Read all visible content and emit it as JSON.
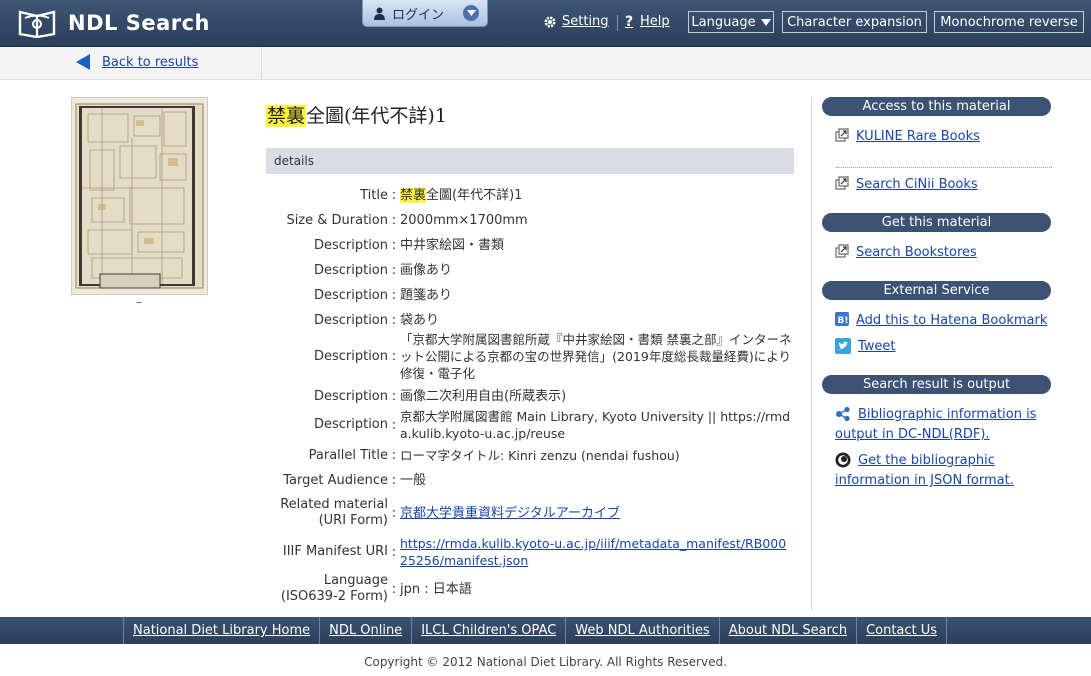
{
  "header": {
    "logo_text": "NDL Search",
    "login_label": "ログイン",
    "setting_label": "Setting",
    "help_label": "Help",
    "language_label": "Language",
    "char_expansion_label": "Character expansion",
    "monochrome_label": "Monochrome reverse"
  },
  "breadcrumb": {
    "back_label": "Back to results"
  },
  "thumbnail": {
    "caption": "–"
  },
  "record": {
    "title_highlight": "禁裏",
    "title_rest": "全圖(年代不詳)1",
    "details_heading": "details",
    "rows": [
      {
        "label": "Title",
        "value_highlight": "禁裏",
        "value": "全圖(年代不詳)1"
      },
      {
        "label": "Size & Duration",
        "value": "2000mm×1700mm"
      },
      {
        "label": "Description",
        "value": "中井家絵図・書類"
      },
      {
        "label": "Description",
        "value": "画像あり"
      },
      {
        "label": "Description",
        "value": "題箋あり"
      },
      {
        "label": "Description",
        "value": "袋あり"
      },
      {
        "label": "Description",
        "value": "「京都大学附属図書館所蔵『中井家絵図・書類 禁裏之部』インターネット公開による京都の宝の世界発信」(2019年度総長裁量経費)により修復・電子化"
      },
      {
        "label": "Description",
        "value": "画像二次利用自由(所蔵表示)"
      },
      {
        "label": "Description",
        "value": "京都大学附属図書館 Main Library, Kyoto University || https://rmda.kulib.kyoto-u.ac.jp/reuse"
      },
      {
        "label": "Parallel Title",
        "value": "ローマ字タイトル: Kinri zenzu (nendai fushou)"
      },
      {
        "label": "Target Audience",
        "value": "一般"
      },
      {
        "label": "Related material (URI Form)",
        "value": "京都大学貴重資料デジタルアーカイブ",
        "link": true
      },
      {
        "label": "IIIF Manifest URI",
        "value": "https://rmda.kulib.kyoto-u.ac.jp/iiif/metadata_manifest/RB00025256/manifest.json",
        "link": true
      },
      {
        "label": "Language (ISO639-2 Form)",
        "value": "jpn : 日本語"
      }
    ]
  },
  "sidebar": {
    "access_heading": "Access to this material",
    "kuline_label": "KULINE Rare Books",
    "cinii_label": "Search CiNii Books",
    "get_heading": "Get this material",
    "bookstores_label": "Search Bookstores",
    "external_heading": "External Service",
    "hatena_label": "Add this to Hatena Bookmark",
    "tweet_label": "Tweet",
    "output_heading": "Search result is output",
    "rdf_label": "Bibliographic information is output in DC-NDL(RDF).",
    "json_label": "Get the bibliographic information in JSON format."
  },
  "footer": {
    "links": [
      "National Diet Library Home",
      "NDL Online",
      "ILCL Children's OPAC",
      "Web NDL Authorities",
      "About NDL Search",
      "Contact Us"
    ],
    "copyright": "Copyright © 2012 National Diet Library. All Rights Reserved."
  },
  "colors": {
    "header_bg": "#344b6a",
    "link": "#1a44a8",
    "highlight": "#fff33d",
    "side_heading_bg": "#3c5375"
  }
}
